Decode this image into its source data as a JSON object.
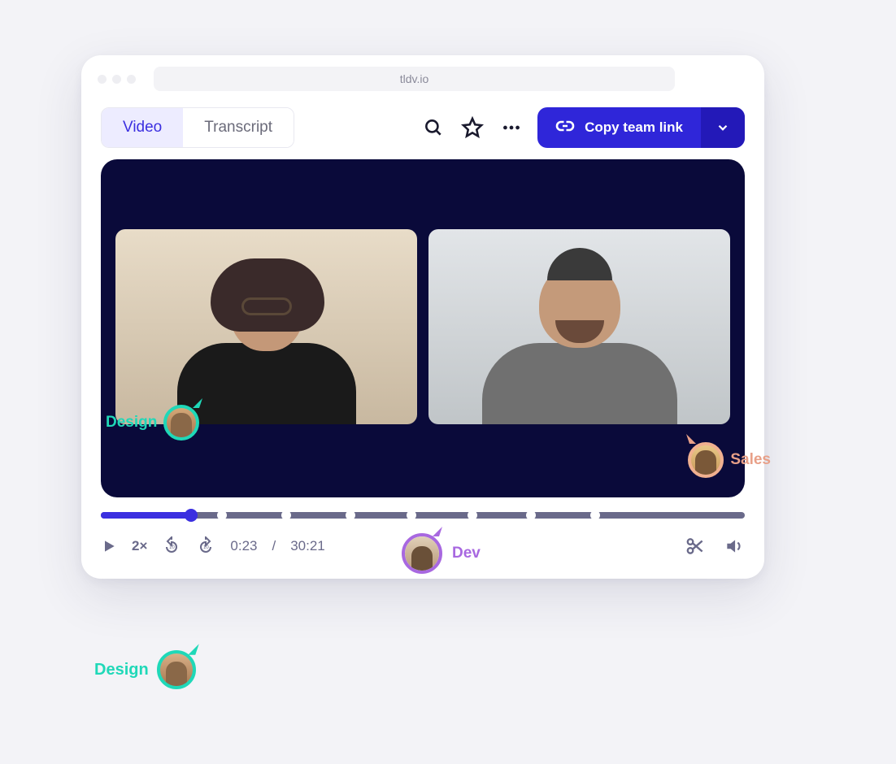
{
  "browser": {
    "url": "tldv.io"
  },
  "tabs": {
    "video": "Video",
    "transcript": "Transcript"
  },
  "copy_button": {
    "label": "Copy team link"
  },
  "playback": {
    "speed": "2×",
    "current_time": "0:23",
    "separator": "/",
    "total_time": "30:21",
    "progress_percent": 14,
    "markers_percent": [
      18,
      28,
      38,
      47.5,
      57,
      66,
      76
    ]
  },
  "cursors": {
    "design_on_video": "Design",
    "sales": "Sales",
    "dev": "Dev",
    "design_floating": "Design"
  },
  "colors": {
    "primary": "#3b2fe0",
    "design": "#1fd8b8",
    "sales": "#e8a088",
    "dev": "#a868e0"
  }
}
